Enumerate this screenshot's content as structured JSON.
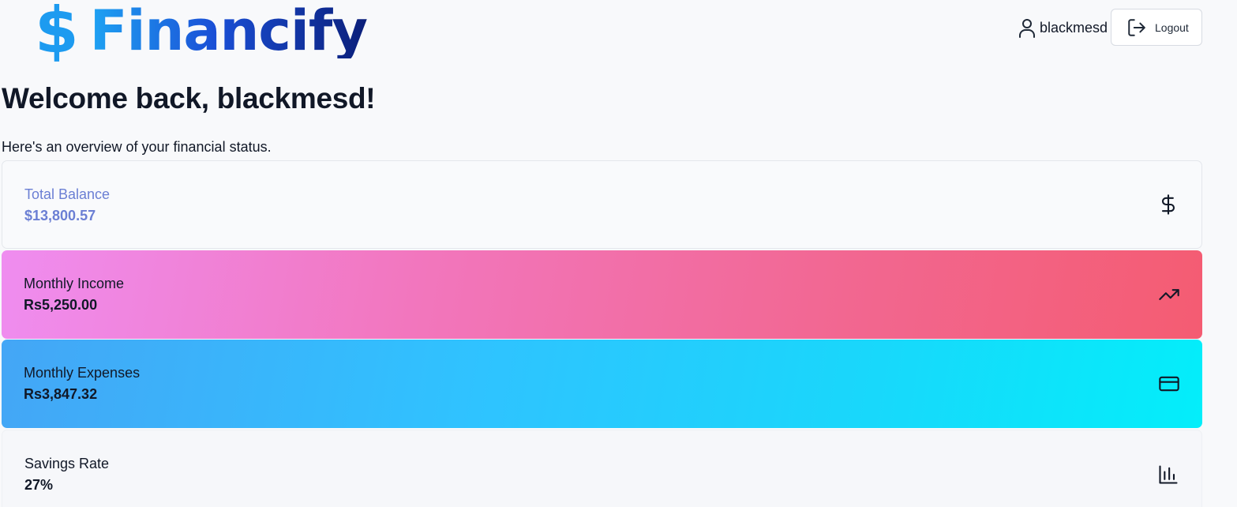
{
  "app": {
    "logo_symbol": "$",
    "logo_text": "Financify",
    "brand_colors": {
      "light": "#1fa3f3",
      "mid": "#1a4fd6",
      "dark": "#0b1f7a"
    }
  },
  "header": {
    "username": "blackmesd",
    "user_icon": "user-icon",
    "logout_label": "Logout",
    "logout_icon": "logout-icon"
  },
  "main": {
    "title": "Welcome back, blackmesd!",
    "subtitle": "Here's an overview of your financial status."
  },
  "cards": [
    {
      "label": "Total Balance",
      "value": "$13,800.57",
      "icon": "dollar-icon",
      "accent": "#6b7fd4"
    },
    {
      "label": "Monthly Income",
      "value": "Rs5,250.00",
      "icon": "trending-up-icon",
      "gradient": [
        "#ef8df0",
        "#f45c72"
      ]
    },
    {
      "label": "Monthly Expenses",
      "value": "Rs3,847.32",
      "icon": "credit-card-icon",
      "gradient": [
        "#44a6f6",
        "#03eefa"
      ]
    },
    {
      "label": "Savings Rate",
      "value": "27%",
      "icon": "bar-chart-icon"
    }
  ]
}
